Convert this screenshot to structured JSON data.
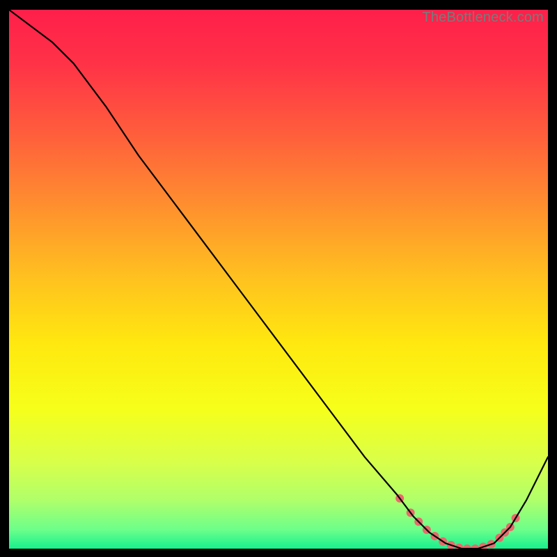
{
  "watermark": "TheBottleneck.com",
  "chart_data": {
    "type": "line",
    "title": "",
    "xlabel": "",
    "ylabel": "",
    "xlim": [
      0,
      100
    ],
    "ylim": [
      0,
      100
    ],
    "grid": false,
    "legend": false,
    "series": [
      {
        "name": "curve",
        "x": [
          0,
          8,
          12,
          18,
          24,
          30,
          36,
          42,
          48,
          54,
          60,
          66,
          72,
          75,
          78,
          81,
          84,
          87,
          90,
          93,
          96,
          100
        ],
        "y": [
          100,
          94,
          90,
          82,
          73,
          65,
          57,
          49,
          41,
          33,
          25,
          17,
          10,
          6,
          3,
          1,
          0,
          0,
          1,
          4,
          9,
          17
        ]
      }
    ],
    "dot_positions_x": [
      72.5,
      74.5,
      76,
      77.5,
      79,
      80.5,
      82,
      83.5,
      85,
      86.5,
      88,
      89.5,
      91,
      92,
      93,
      94
    ],
    "gradient_stops": [
      {
        "offset": 0.0,
        "color": "#ff1f4a"
      },
      {
        "offset": 0.1,
        "color": "#ff3247"
      },
      {
        "offset": 0.22,
        "color": "#ff5a3d"
      },
      {
        "offset": 0.35,
        "color": "#ff8a30"
      },
      {
        "offset": 0.5,
        "color": "#ffc21f"
      },
      {
        "offset": 0.62,
        "color": "#ffe80f"
      },
      {
        "offset": 0.74,
        "color": "#f6ff1a"
      },
      {
        "offset": 0.84,
        "color": "#d8ff4a"
      },
      {
        "offset": 0.91,
        "color": "#b0ff6a"
      },
      {
        "offset": 0.965,
        "color": "#6cff8a"
      },
      {
        "offset": 1.0,
        "color": "#18ef8d"
      }
    ],
    "dot_color": "#e96a6c",
    "curve_color": "#000000"
  }
}
